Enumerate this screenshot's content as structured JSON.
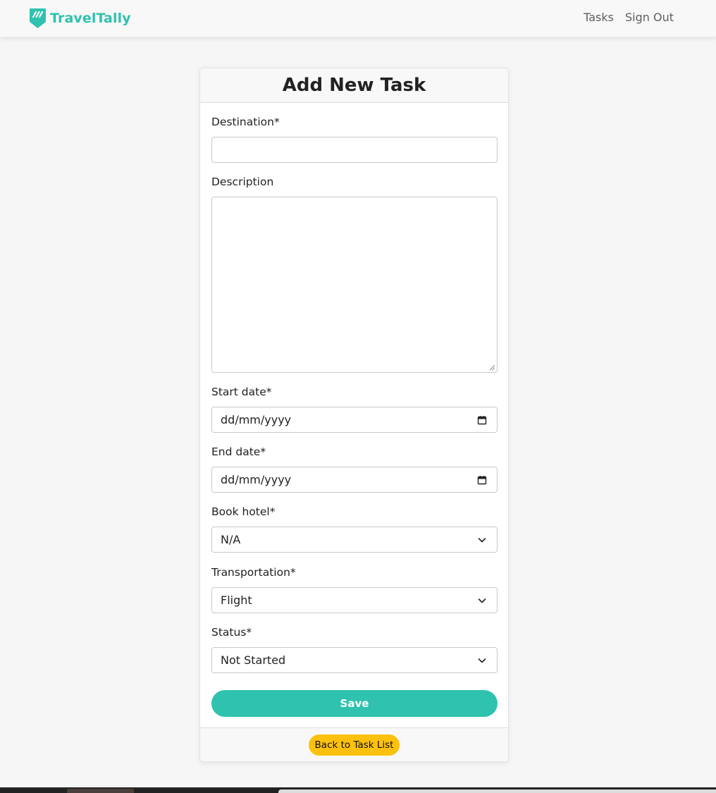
{
  "navbar": {
    "brand_name": "TravelTally",
    "links": [
      "Tasks",
      "Sign Out"
    ],
    "brand_color": "#2fc2ae"
  },
  "form": {
    "title": "Add New Task",
    "fields": {
      "destination": {
        "label": "Destination*",
        "value": ""
      },
      "description": {
        "label": "Description",
        "value": ""
      },
      "start_date": {
        "label": "Start date*",
        "placeholder": "dd/mm/yyyy"
      },
      "end_date": {
        "label": "End date*",
        "placeholder": "dd/mm/yyyy"
      },
      "book_hotel": {
        "label": "Book hotel*",
        "selected": "N/A"
      },
      "transportation": {
        "label": "Transportation*",
        "selected": "Flight"
      },
      "status": {
        "label": "Status*",
        "selected": "Not Started"
      }
    },
    "save_label": "Save",
    "back_label": "Back to Task List"
  },
  "colors": {
    "accent": "#2fc2ae",
    "back_button": "#fcc10d"
  },
  "icons": {
    "logo": "traveltally-logo-icon",
    "calendar": "calendar-icon",
    "select": "chevron-down-icon"
  }
}
